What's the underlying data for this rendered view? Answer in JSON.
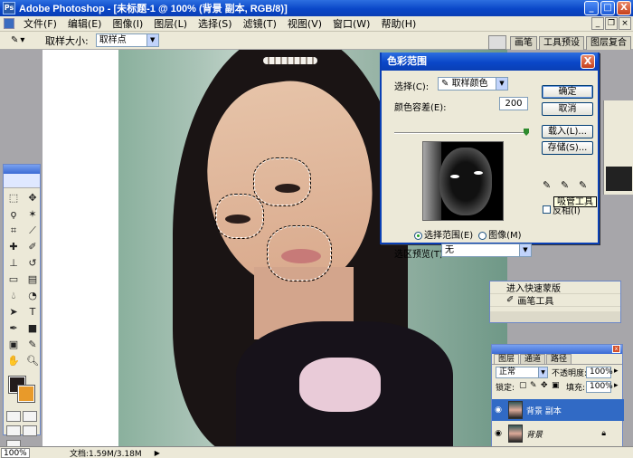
{
  "window": {
    "title": "Adobe Photoshop - [未标题-1 @ 100% (背景 副本, RGB/8)]",
    "buttons": {
      "minimize": "_",
      "maximize": "□",
      "close": "X"
    },
    "mdi_buttons": {
      "minimize": "_",
      "restore": "❐",
      "close": "×"
    }
  },
  "menu": [
    "文件(F)",
    "编辑(E)",
    "图像(I)",
    "图层(L)",
    "选择(S)",
    "滤镜(T)",
    "视图(V)",
    "窗口(W)",
    "帮助(H)"
  ],
  "options": {
    "sample_size_label": "取样大小:",
    "sample_size_value": "取样点"
  },
  "palette_well": {
    "tabs": [
      "画笔",
      "工具预设",
      "图层复合"
    ]
  },
  "dialog": {
    "title": "色彩范围",
    "close": "X",
    "select_label": "选择(C):",
    "select_value": "取样颜色",
    "fuzziness_label": "颜色容差(E):",
    "fuzziness_value": "200",
    "fuzziness_fraction": 1.0,
    "radio_selection": "选择范围(E)",
    "radio_image": "图像(M)",
    "preview_label": "选区预览(T):",
    "preview_value": "无",
    "btn_ok": "确定",
    "btn_cancel": "取消",
    "btn_load": "载入(L)...",
    "btn_save": "存储(S)...",
    "invert_label": "反相(I)",
    "tooltip": "吸管工具"
  },
  "actions_panel": {
    "rows": [
      "进入快速蒙版",
      "画笔工具"
    ]
  },
  "layers_panel": {
    "tabs": [
      "图层",
      "通道",
      "路径"
    ],
    "blend_mode": "正常",
    "opacity_label": "不透明度:",
    "opacity_value": "100%",
    "lock_label": "锁定:",
    "fill_label": "填充:",
    "fill_value": "100%",
    "layers": [
      {
        "name": "背景 副本",
        "selected": true
      },
      {
        "name": "背景",
        "selected": false
      }
    ]
  },
  "status": {
    "zoom": "100%",
    "doc": "文档:1.59M/3.18M",
    "arrow": "▶"
  },
  "colors": {
    "foreground": "#231c1c",
    "background": "#e89a2a",
    "titlebar": "#0a47c8"
  },
  "icons": {
    "eyedropper": "eyedropper-icon",
    "eyedropper_plus": "eyedropper-plus-icon",
    "eyedropper_minus": "eyedropper-minus-icon",
    "visibility": "eye-icon",
    "lock": "lock-icon"
  }
}
